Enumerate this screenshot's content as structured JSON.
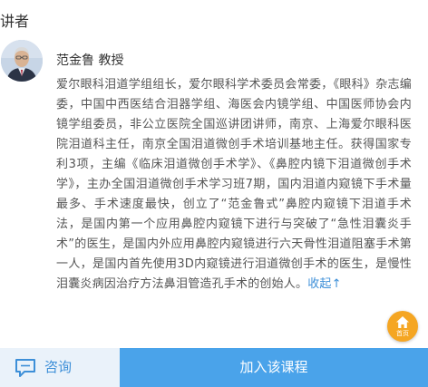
{
  "section": {
    "title": "讲者"
  },
  "teacher": {
    "name": "范金鲁 教授",
    "bio": "爱尔眼科泪道学组组长，爱尔眼科学术委员会常委，《眼科》杂志编委，中国中西医结合泪器学组、海医会内镜学组、中国医师协会内镜学组委员，非公立医院全国巡讲团讲师，南京、上海爱尔眼科医院泪道科主任，南京全国泪道微创手术培训基地主任。获得国家专利3项，主编《临床泪道微创手术学》、《鼻腔内镜下泪道微创手术学》，主办全国泪道微创手术学习班7期，国内泪道内窥镜下手术量最多、手术速度最快，创立了“范金鲁式”鼻腔内窥镜下泪道手术法，是国内第一个应用鼻腔内窥镜下进行与突破了“急性泪囊炎手术”的医生，是国内外应用鼻腔内窥镜进行六天骨性泪道阻塞手术第一人，是国内首先使用3D内窥镜进行泪道微创手术的医生，是慢性泪囊炎病因治疗方法鼻泪管造孔手术的创始人。",
    "collapse_label": "收起↑"
  },
  "fab": {
    "label": "首页",
    "icon": "home-icon",
    "color": "#f5a623"
  },
  "bottom_bar": {
    "consult_label": "咨询",
    "consult_icon": "chat-bubble-icon",
    "enroll_label": "加入该课程",
    "accent_color": "#4aa3ea"
  }
}
